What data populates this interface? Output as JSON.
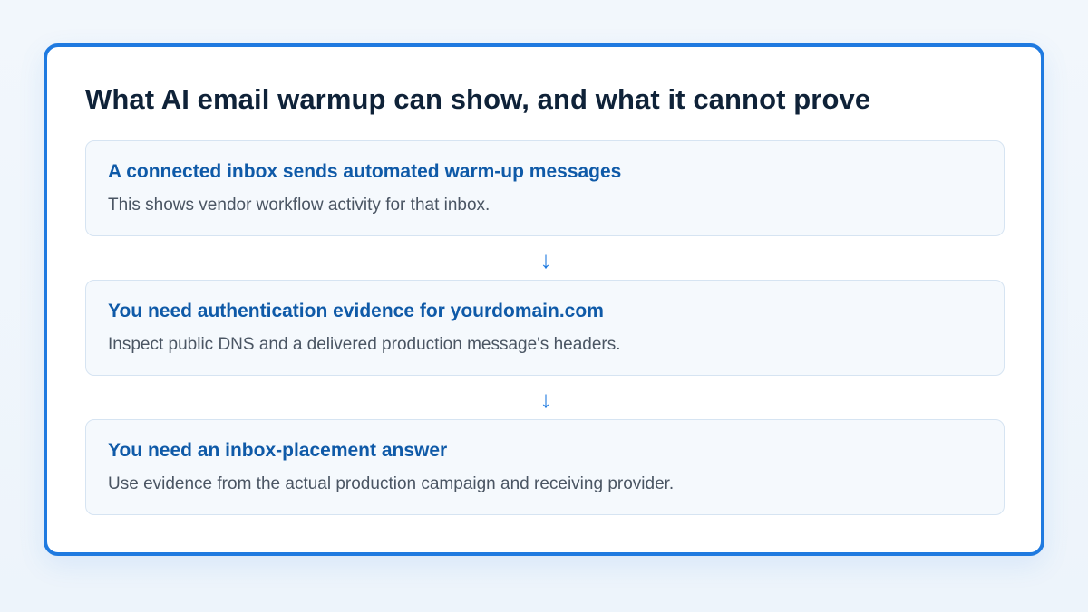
{
  "diagram": {
    "title": "What AI email warmup can show, and what it cannot prove",
    "steps": [
      {
        "title": "A connected inbox sends automated warm-up messages",
        "description": "This shows vendor workflow activity for that inbox."
      },
      {
        "title": "You need authentication evidence for yourdomain.com",
        "description": "Inspect public DNS and a delivered production message's headers."
      },
      {
        "title": "You need an inbox-placement answer",
        "description": "Use evidence from the actual production campaign and receiving provider."
      }
    ],
    "connector_icon": "arrow-down-icon",
    "colors": {
      "accent": "#1f7ae0",
      "step_title": "#0f5aa8",
      "heading": "#0f2238"
    }
  }
}
